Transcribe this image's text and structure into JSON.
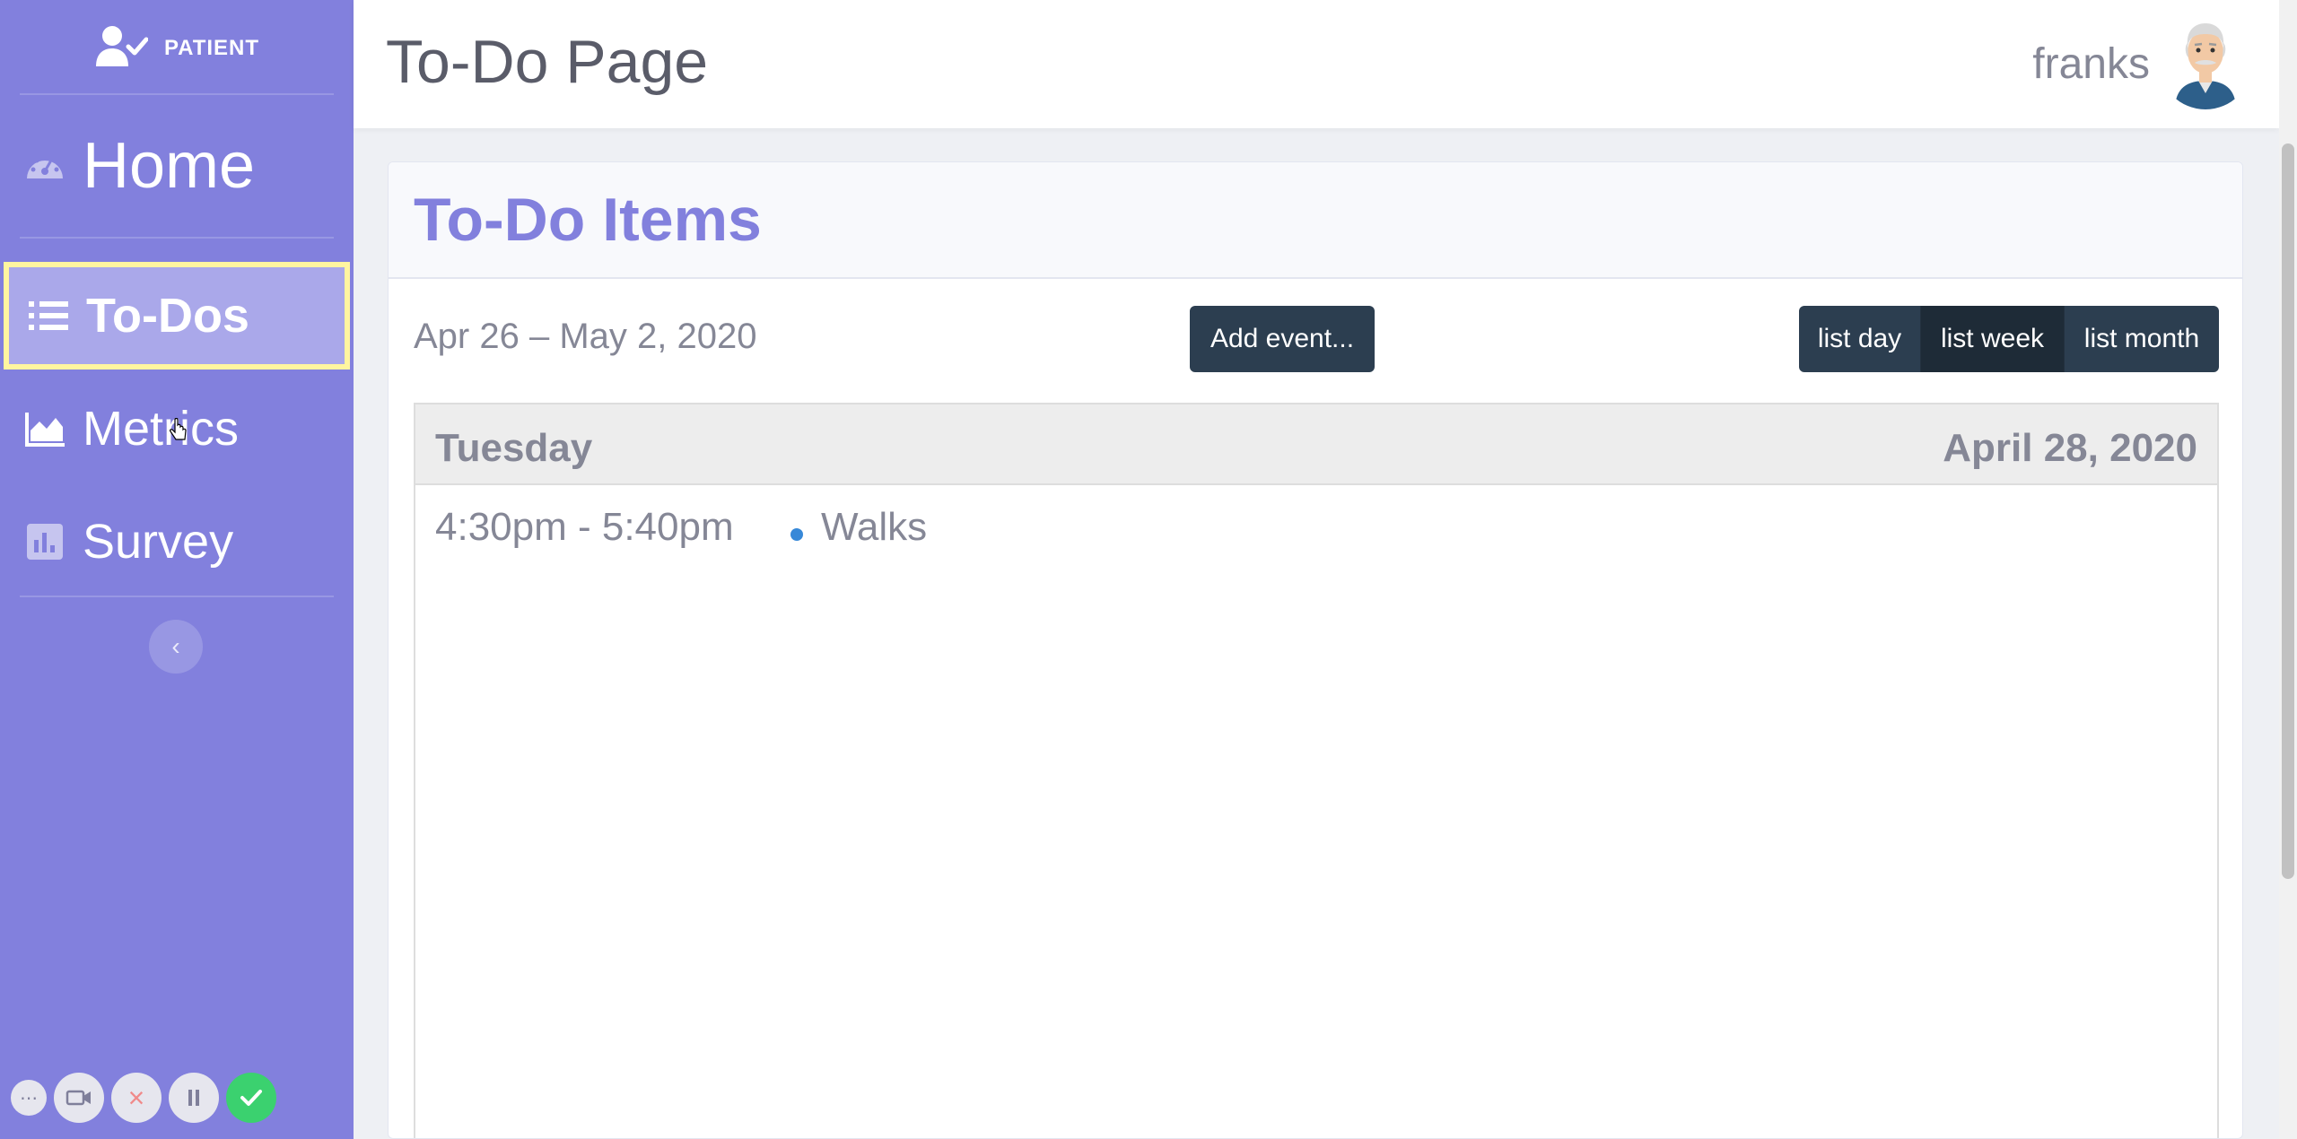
{
  "sidebar": {
    "brand": {
      "label": "PATIENT",
      "icon": "user-check-icon"
    },
    "items": [
      {
        "label": "Home",
        "icon": "tachometer-icon",
        "active": false
      },
      {
        "label": "To-Dos",
        "icon": "list-icon",
        "active": true
      },
      {
        "label": "Metrics",
        "icon": "area-chart-icon",
        "active": false
      },
      {
        "label": "Survey",
        "icon": "poll-icon",
        "active": false
      }
    ],
    "collapse_glyph": "‹"
  },
  "header": {
    "title": "To-Do Page",
    "username": "franks",
    "avatar": "old-man-avatar"
  },
  "card": {
    "title": "To-Do Items",
    "date_range": "Apr 26 – May 2, 2020",
    "add_event_label": "Add event...",
    "views": [
      {
        "label": "list day",
        "active": false
      },
      {
        "label": "list week",
        "active": true
      },
      {
        "label": "list month",
        "active": false
      }
    ],
    "days": [
      {
        "day_name": "Tuesday",
        "date": "April 28, 2020",
        "events": [
          {
            "time": "4:30pm - 5:40pm",
            "title": "Walks",
            "dot_color": "#3788d8"
          }
        ]
      }
    ]
  },
  "recorder": {
    "buttons": [
      "more-icon",
      "camera-icon",
      "stop-icon",
      "pause-icon",
      "check-icon"
    ]
  },
  "colors": {
    "sidebar": "#8280dd",
    "accent_title": "#8280dd",
    "active_outline": "#fff5a0",
    "button_dark": "#2c3e50",
    "record_done": "#3bd16f"
  }
}
